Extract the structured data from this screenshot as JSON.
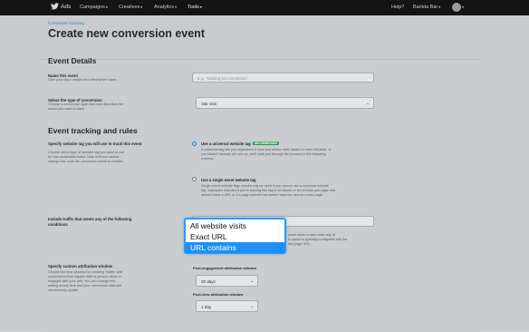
{
  "nav": {
    "brand": "Ads",
    "menus": [
      "Campaigns",
      "Creatives",
      "Analytics",
      "Tools"
    ],
    "help": "Help?",
    "account": "Barista Bar"
  },
  "breadcrumb": "Conversion tracking",
  "page_title": "Create new conversion event",
  "event_details": {
    "heading": "Event Details",
    "name_label": "Name this event",
    "name_help": "Give your tag a unique and descriptive name.",
    "name_placeholder": "E.g. \"Mailing list completion\"",
    "type_label": "Select the type of conversion",
    "type_help": [
      "Choose a conversion type that best describes the",
      "action you want to track."
    ],
    "type_value": "Site visit"
  },
  "tracking": {
    "heading": "Event tracking and rules",
    "tag_label": "Specify website tag you will use to track this event",
    "tag_help": [
      "Choose which type of website tag you want to use",
      "for this conversion event. Note that you cannot",
      "change this once the conversion event is created."
    ],
    "universal_label": "Use a universal website tag",
    "universal_badge": "RECOMMENDED",
    "universal_desc": [
      "A universal tag lets you implement it once and define rules based on user behavior. If",
      "you haven't already set one up, we'll walk you through the process in the following",
      "screens."
    ],
    "single_label": "Use a single event website tag",
    "single_desc": [
      "Single event website tags should only be used if you cannot use a universal website",
      "tag, examples included if you're placing this tag in an iframe or for a thank-you page that",
      "doesn't have a URL or if a page submit that doesn't lead the user to a web page."
    ],
    "rules_label": "Include traffic that meets any of the following",
    "rules_label2": "conditions",
    "rules_right": [
      "event when a user visits any of",
      "is option is typically configured with the",
      "any page URL."
    ]
  },
  "dropdown": {
    "options": [
      "All website visits",
      "Exact URL",
      "URL contains"
    ],
    "selected": "URL contains"
  },
  "attribution": {
    "label": "Specify custom attribution window",
    "help": [
      "Choose the time window for crediting Twitter with",
      "conversions that happen after a person views or",
      "engages with your ads. You can change this",
      "setting at any time and your conversion data will",
      "retroactively update."
    ],
    "post_engagement_label": "Post-engagement attribution window",
    "post_engagement_value": "30 days",
    "post_view_label": "Post-view attribution window",
    "post_view_value": "1 day"
  }
}
